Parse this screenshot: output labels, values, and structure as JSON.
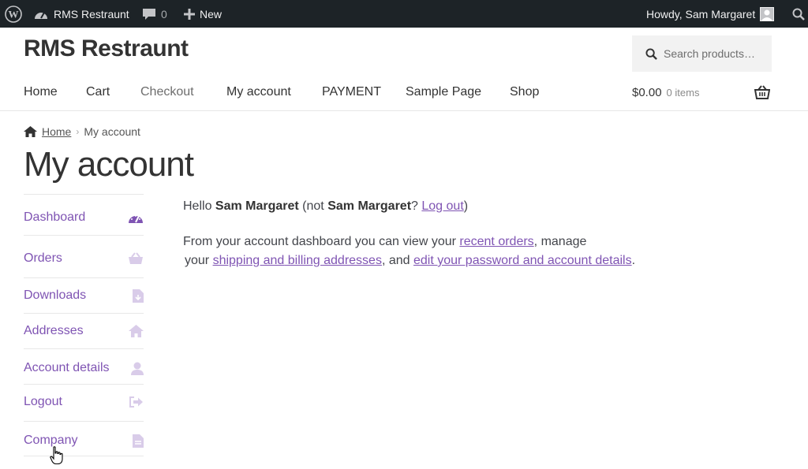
{
  "admin_bar": {
    "site_name": "RMS Restraunt",
    "comments_count": "0",
    "new_label": "New",
    "howdy": "Howdy, Sam Margaret"
  },
  "header": {
    "site_title": "RMS Restraunt",
    "search_placeholder": "Search products…",
    "nav": [
      "Home",
      "Cart",
      "Checkout",
      "My account",
      "PAYMENT",
      "Sample Page",
      "Shop"
    ],
    "cart_total": "$0.00",
    "cart_items": "0 items"
  },
  "breadcrumb": {
    "home": "Home",
    "current": "My account"
  },
  "page_title": "My account",
  "account_nav": [
    {
      "label": "Dashboard",
      "icon": "dashboard-icon"
    },
    {
      "label": "Orders",
      "icon": "basket-icon"
    },
    {
      "label": "Downloads",
      "icon": "file-download-icon"
    },
    {
      "label": "Addresses",
      "icon": "home-icon"
    },
    {
      "label": "Account details",
      "icon": "user-icon"
    },
    {
      "label": "Logout",
      "icon": "sign-out-icon"
    },
    {
      "label": "Company",
      "icon": "file-icon"
    }
  ],
  "content": {
    "hello_prefix": "Hello ",
    "user_name": "Sam Margaret",
    "not_prefix": " (not ",
    "user_name_2": "Sam Margaret",
    "question": "? ",
    "logout_link": "Log out",
    "close_paren": ")",
    "dash_text_1": "From your account dashboard you can view your ",
    "recent_orders_link": "recent orders",
    "dash_text_2": ", manage",
    "dash_text_3": "your ",
    "shipping_link": "shipping and",
    "billing_link": " billing addresses",
    "dash_text_4": ", and ",
    "password_link": "edit your password and account details",
    "dash_text_5": "."
  },
  "colors": {
    "accent": "#7f54b3",
    "admin_bar": "#1d2327",
    "text": "#43454b"
  }
}
